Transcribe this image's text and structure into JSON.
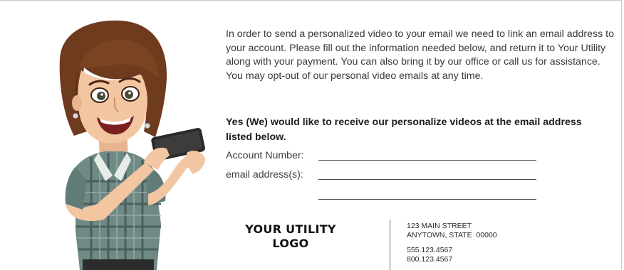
{
  "intro_text": "In order to send a personalized video to your email we need to link an email address to your account. Please fill out the information needed below, and return it to Your Utility along with your payment. You can also bring it by our office or call us for assistance. You may opt-out of our personal video emails at any time.",
  "optin_text": "Yes (We) would like to receive our personalize videos at the email address listed below.",
  "form": {
    "account_label": "Account Number:",
    "email_label": "email address(s):"
  },
  "logo": {
    "line1": "YOUR UTILITY",
    "line2": "LOGO"
  },
  "contact": {
    "street": "123 MAIN STREET",
    "city": "ANYTOWN, STATE  00000",
    "phone1": "555.123.4567",
    "phone2": "800.123.4567"
  }
}
